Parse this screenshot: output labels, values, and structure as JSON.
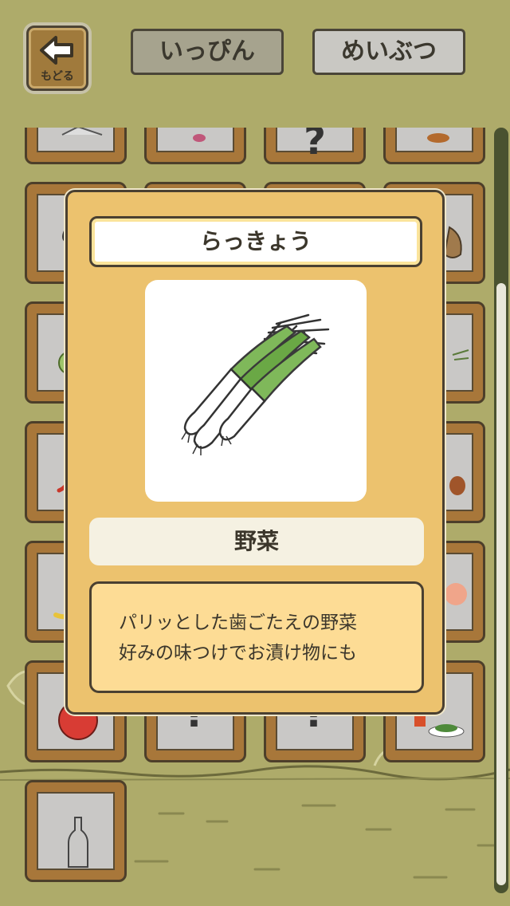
{
  "header": {
    "back_label": "もどる",
    "tabs": [
      {
        "label": "いっぴん",
        "selected": true
      },
      {
        "label": "めいぶつ",
        "selected": false
      }
    ]
  },
  "grid": {
    "unknown_symbol": "?"
  },
  "item_detail": {
    "name": "らっきょう",
    "category": "野菜",
    "description": [
      "パリッとした歯ごたえの野菜",
      "好みの味つけでお漬け物にも"
    ]
  },
  "colors": {
    "background": "#aeab6a",
    "panel": "#ecc26e",
    "description_bg": "#fddc95",
    "tile_frame": "#a8773a"
  }
}
